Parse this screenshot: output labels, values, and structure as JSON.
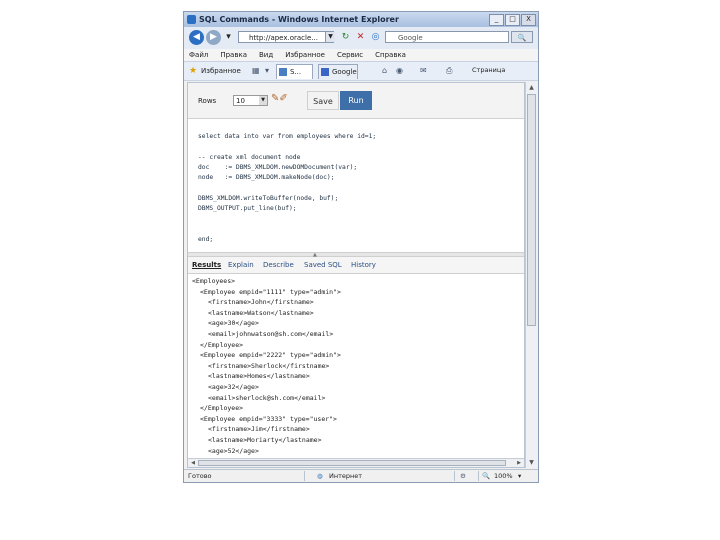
{
  "window": {
    "title": "SQL Commands - Windows Internet Explorer",
    "min_label": "_",
    "max_label": "□",
    "close_label": "X"
  },
  "addressbar": {
    "back_label": "◀",
    "forward_label": "▶",
    "url": "http://apex.oracle...",
    "search_placeholder": "Google",
    "search_button": "🔍"
  },
  "menu": {
    "items": [
      "Файл",
      "Правка",
      "Вид",
      "Избранное",
      "Сервис",
      "Справка"
    ]
  },
  "favorites": {
    "label": "Избранное",
    "tabs": [
      {
        "label": "S..."
      },
      {
        "label": "Google"
      }
    ],
    "page_label": "Страница"
  },
  "command_bar": {
    "rows_label": "Rows",
    "rows_value": "10",
    "save_label": "Save",
    "run_label": "Run"
  },
  "editor": {
    "lines": [
      "select data into var from employees where id=1;",
      "",
      "-- create xml document node",
      "doc    := DBMS_XMLDOM.newDOMDocument(var);",
      "node   := DBMS_XMLDOM.makeNode(doc);",
      "",
      "DBMS_XMLDOM.writeToBuffer(node, buf);",
      "DBMS_OUTPUT.put_line(buf);",
      "",
      "",
      "end;"
    ]
  },
  "result_tabs": [
    "Results",
    "Explain",
    "Describe",
    "Saved SQL",
    "History"
  ],
  "xml_output": [
    {
      "indent": 0,
      "text": "<Employees>"
    },
    {
      "indent": 1,
      "text": "<Employee empid=\"1111\" type=\"admin\">"
    },
    {
      "indent": 2,
      "text": "<firstname>John</firstname>"
    },
    {
      "indent": 2,
      "text": "<lastname>Watson</lastname>"
    },
    {
      "indent": 2,
      "text": "<age>30</age>"
    },
    {
      "indent": 2,
      "text": "<email>johnwatson@sh.com</email>"
    },
    {
      "indent": 1,
      "text": "</Employee>"
    },
    {
      "indent": 1,
      "text": "<Employee empid=\"2222\" type=\"admin\">"
    },
    {
      "indent": 2,
      "text": "<firstname>Sherlock</firstname>"
    },
    {
      "indent": 2,
      "text": "<lastname>Homes</lastname>"
    },
    {
      "indent": 2,
      "text": "<age>32</age>"
    },
    {
      "indent": 2,
      "text": "<email>sherlock@sh.com</email>"
    },
    {
      "indent": 1,
      "text": "</Employee>"
    },
    {
      "indent": 1,
      "text": "<Employee empid=\"3333\" type=\"user\">"
    },
    {
      "indent": 2,
      "text": "<firstname>Jim</firstname>"
    },
    {
      "indent": 2,
      "text": "<lastname>Moriarty</lastname>"
    },
    {
      "indent": 2,
      "text": "<age>52</age>"
    }
  ],
  "status": {
    "left": "Готово",
    "zone": "Интернет",
    "zoom": "100%"
  }
}
